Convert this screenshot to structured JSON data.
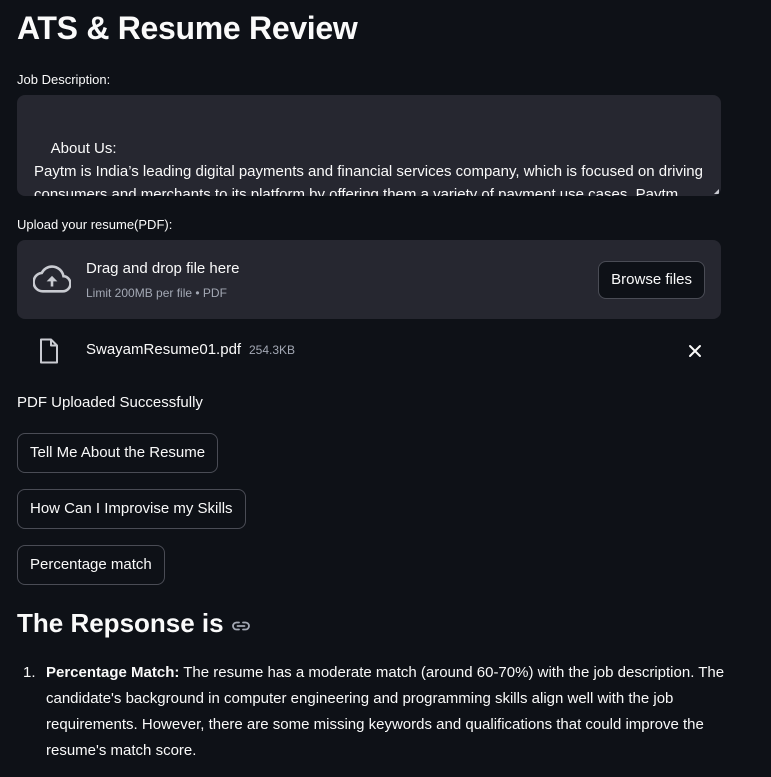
{
  "app": {
    "title": "ATS & Resume Review"
  },
  "job_description": {
    "label": "Job Description:",
    "value": "About Us:\nPaytm is India’s leading digital payments and financial services company, which is focused on driving consumers and merchants to its platform by offering them a variety of payment use cases. Paytm provides consumers with services like utility payments and money transfers, while"
  },
  "upload": {
    "label": "Upload your resume(PDF):",
    "drop_title": "Drag and drop file here",
    "drop_subtitle": "Limit 200MB per file • PDF",
    "browse_label": "Browse files",
    "icon": "cloud-upload-icon"
  },
  "uploaded_file": {
    "name": "SwayamResume01.pdf",
    "size": "254.3KB",
    "icon": "file-icon"
  },
  "status": "PDF Uploaded Successfully",
  "actions": [
    {
      "label": "Tell Me About the Resume"
    },
    {
      "label": "How Can I Improvise my Skills"
    },
    {
      "label": "Percentage match"
    }
  ],
  "response": {
    "heading": "The Repsonse is",
    "items": [
      {
        "number": "1.",
        "bold": "Percentage Match:",
        "text": " The resume has a moderate match (around 60-70%) with the job description. The candidate's background in computer engineering and programming skills align well with the job requirements. However, there are some missing keywords and qualifications that could improve the resume's match score."
      }
    ]
  },
  "colors": {
    "background": "#0e1117",
    "surface": "#262730",
    "text": "#fafafa",
    "muted": "#a3a8b4",
    "border": "#4a4c55"
  }
}
